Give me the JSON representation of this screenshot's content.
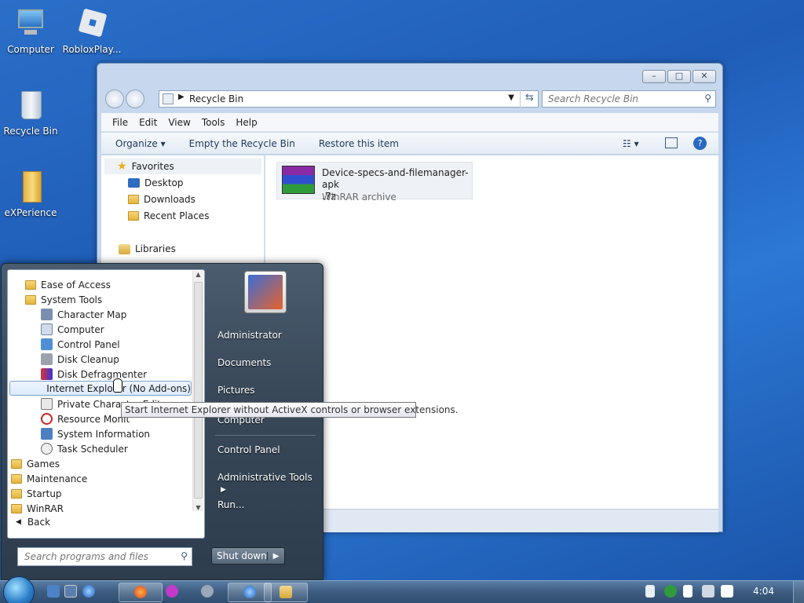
{
  "desktop": {
    "icons": [
      {
        "label": "Computer"
      },
      {
        "label": "RobloxPlay..."
      },
      {
        "label": "Recycle Bin"
      },
      {
        "label": "eXPerience"
      }
    ]
  },
  "explorer": {
    "address": "Recycle Bin",
    "search_placeholder": "Search Recycle Bin",
    "menu": [
      "File",
      "Edit",
      "View",
      "Tools",
      "Help"
    ],
    "toolbar": {
      "organize": "Organize",
      "empty": "Empty the Recycle Bin",
      "restore": "Restore this item"
    },
    "nav": {
      "favorites": "Favorites",
      "desktop": "Desktop",
      "downloads": "Downloads",
      "recent": "Recent Places",
      "libraries": "Libraries"
    },
    "file": {
      "name_line1": "Device-specs-and-filemanager-apk",
      "name_line2": ".7z",
      "type": "WinRAR archive"
    }
  },
  "start_menu": {
    "programs": [
      "Ease of Access",
      "System Tools",
      "Character Map",
      "Computer",
      "Control Panel",
      "Disk Cleanup",
      "Disk Defragmenter",
      "Internet Explorer (No Add-ons)",
      "Private Character Editor",
      "Resource Monit",
      "System Information",
      "Task Scheduler",
      "Games",
      "Maintenance",
      "Startup",
      "WinRAR"
    ],
    "back": "Back",
    "search_placeholder": "Search programs and files",
    "right": {
      "administrator": "Administrator",
      "documents": "Documents",
      "pictures": "Pictures",
      "computer": "Computer",
      "control_panel": "Control Panel",
      "admin_tools": "Administrative Tools",
      "run": "Run..."
    },
    "shutdown": "Shut down",
    "tooltip": "Start Internet Explorer without ActiveX controls or browser extensions."
  },
  "taskbar": {
    "clock": "4:04"
  }
}
